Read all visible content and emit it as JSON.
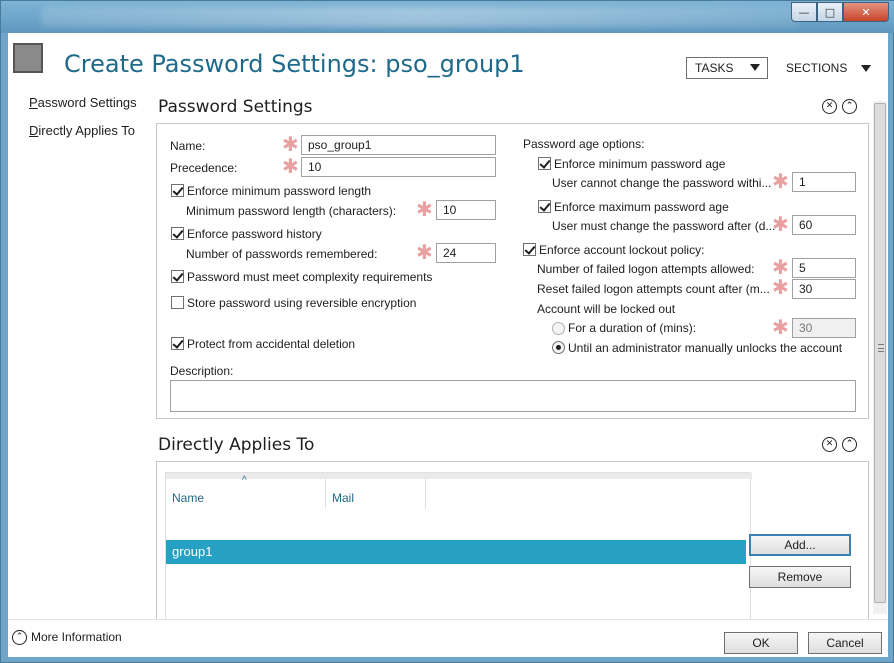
{
  "window": {
    "min_glyph": "—",
    "max_glyph": "□",
    "close_glyph": "✕"
  },
  "header": {
    "title": "Create Password Settings: pso_group1",
    "tasks_label": "TASKS",
    "sections_label": "SECTIONS"
  },
  "nav": {
    "items": [
      {
        "label": "Password Settings",
        "underline": "P"
      },
      {
        "label": "Directly Applies To",
        "underline": "D"
      }
    ]
  },
  "password_settings": {
    "title": "Password Settings",
    "close_glyph": "✕",
    "collapse_glyph": "⌃",
    "required_glyph": "✱",
    "name_label": "Name:",
    "name_value": "pso_group1",
    "precedence_label": "Precedence:",
    "precedence_value": "10",
    "enforce_min_length_label": "Enforce minimum password length",
    "enforce_min_length_checked": true,
    "min_length_label": "Minimum password length (characters):",
    "min_length_value": "10",
    "enforce_history_label": "Enforce password history",
    "enforce_history_checked": true,
    "history_label": "Number of passwords remembered:",
    "history_value": "24",
    "complexity_label": "Password must meet complexity requirements",
    "complexity_checked": true,
    "reversible_label": "Store password using reversible encryption",
    "reversible_checked": false,
    "protect_label": "Protect from accidental deletion",
    "protect_checked": true,
    "description_label": "Description:",
    "description_value": "",
    "age_options_label": "Password age options:",
    "enforce_min_age_label": "Enforce minimum password age",
    "enforce_min_age_checked": true,
    "min_age_label": "User cannot change the password withi...",
    "min_age_value": "1",
    "enforce_max_age_label": "Enforce maximum password age",
    "enforce_max_age_checked": true,
    "max_age_label": "User must change the password after (d...",
    "max_age_value": "60",
    "lockout_label": "Enforce account lockout policy:",
    "lockout_checked": true,
    "failed_attempts_label": "Number of failed logon attempts allowed:",
    "failed_attempts_value": "5",
    "reset_after_label": "Reset failed logon attempts count after (m...",
    "reset_after_value": "30",
    "locked_out_label": "Account will be locked out",
    "duration_label": "For a duration of (mins):",
    "duration_value": "30",
    "duration_selected": false,
    "until_admin_label": "Until an administrator manually unlocks the account",
    "until_admin_selected": true
  },
  "directly_applies": {
    "title": "Directly Applies To",
    "close_glyph": "✕",
    "collapse_glyph": "⌃",
    "columns": [
      "Name",
      "Mail"
    ],
    "sort_glyph": "^",
    "rows": [
      {
        "name": "group1",
        "mail": ""
      }
    ],
    "add_label": "Add...",
    "remove_label": "Remove"
  },
  "footer": {
    "more_info_glyph": "⌃",
    "more_info_label": "More Information",
    "ok_label": "OK",
    "cancel_label": "Cancel"
  },
  "colors": {
    "title_blue": "#1f6a8a",
    "selection": "#26a0c3",
    "required_star": "#e8a0a0"
  }
}
